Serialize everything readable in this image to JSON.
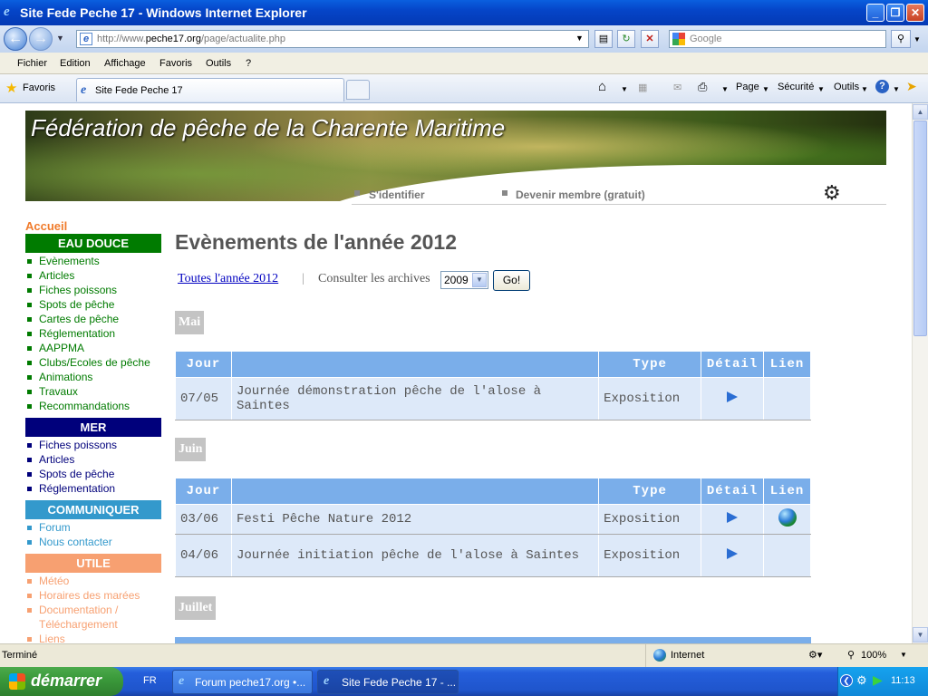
{
  "window": {
    "title": "Site Fede Peche 17 - Windows Internet Explorer",
    "min": "_",
    "max": "❐",
    "close": "✕"
  },
  "address": {
    "prefix": "http://www.",
    "domain": "peche17.org",
    "path": "/page/actualite.php",
    "search_placeholder": "Google"
  },
  "menu": [
    "Fichier",
    "Edition",
    "Affichage",
    "Favoris",
    "Outils",
    "?"
  ],
  "favbar": {
    "favorites": "Favoris",
    "tab_title": "Site Fede Peche 17",
    "page_menu": "Page",
    "security_menu": "Sécurité",
    "tools_menu": "Outils"
  },
  "banner": {
    "title": "Fédération de pêche de la Charente Maritime",
    "login": "S'identifier",
    "register": "Devenir membre (gratuit)"
  },
  "sidebar": {
    "home": "Accueil",
    "eau_douce": {
      "title": "EAU DOUCE",
      "color": "#007b00",
      "items": [
        "Evènements",
        "Articles",
        "Fiches poissons",
        "Spots de pêche",
        "Cartes de pêche",
        "Réglementation",
        "AAPPMA",
        "Clubs/Ecoles de pêche",
        "Animations",
        "Travaux",
        "Recommandations"
      ]
    },
    "mer": {
      "title": "MER",
      "color": "#00007b",
      "items": [
        "Fiches poissons",
        "Articles",
        "Spots de pêche",
        "Réglementation"
      ]
    },
    "communiquer": {
      "title": "COMMUNIQUER",
      "color": "#3399cc",
      "items": [
        "Forum",
        "Nous contacter"
      ]
    },
    "utile": {
      "title": "UTILE",
      "color": "#f7a071",
      "items": [
        "Météo",
        "Horaires des marées",
        "Documentation /",
        "Téléchargement",
        "Liens"
      ]
    }
  },
  "main": {
    "heading": "Evènements de l'année 2012",
    "all_year": "Toutes l'année 2012",
    "separator": "|",
    "consult": "Consulter les archives",
    "year_value": "2009",
    "go": "Go!",
    "headers": {
      "day": "Jour",
      "type": "Type",
      "detail": "Détail",
      "link": "Lien"
    },
    "months": [
      {
        "name": "Mai",
        "rows": [
          {
            "day": "07/05",
            "title": "Journée démonstration pêche de l'alose à Saintes",
            "type": "Exposition",
            "detail": true,
            "link": false
          }
        ]
      },
      {
        "name": "Juin",
        "rows": [
          {
            "day": "03/06",
            "title": "Festi Pêche Nature 2012",
            "type": "Exposition",
            "detail": true,
            "link": true
          },
          {
            "day": "04/06",
            "title": "Journée initiation pêche de l'alose à Saintes",
            "type": "Exposition",
            "detail": true,
            "link": false
          }
        ]
      },
      {
        "name": "Juillet",
        "rows": []
      }
    ]
  },
  "status": {
    "text": "Terminé",
    "zone": "Internet",
    "zoom": "100%"
  },
  "taskbar": {
    "start": "démarrer",
    "lang": "FR",
    "tasks": [
      "Forum peche17.org •...",
      "Site Fede Peche 17 - ..."
    ],
    "clock": "11:13"
  }
}
